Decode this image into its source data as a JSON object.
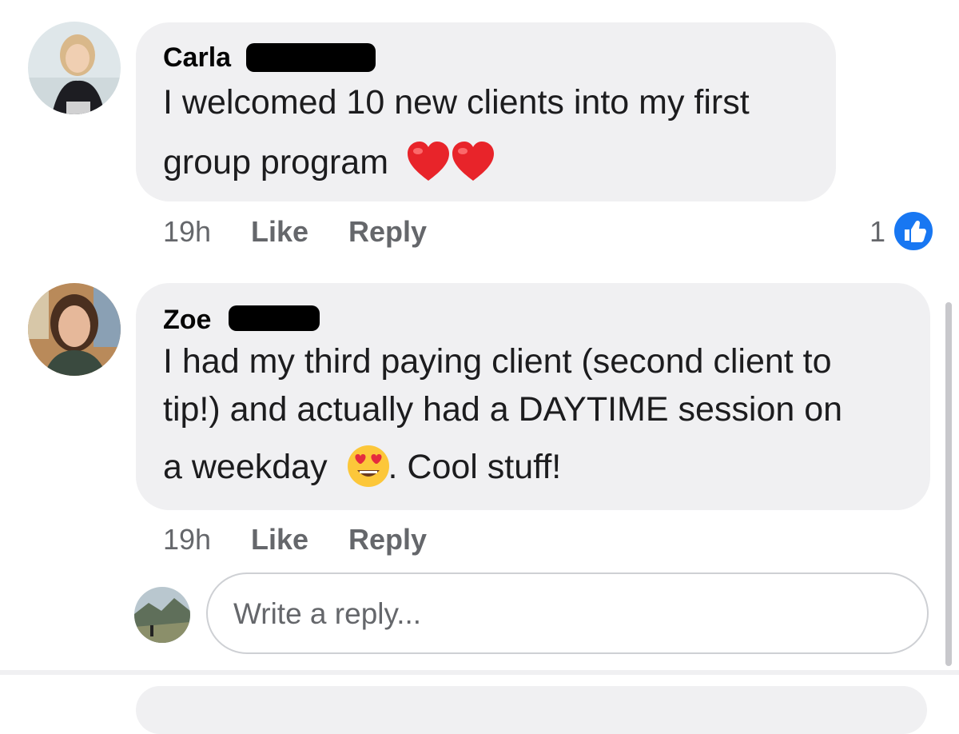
{
  "comments": [
    {
      "author": "Carla",
      "text_lines": [
        "I welcomed 10 new clients into my first",
        "group program"
      ],
      "trailing_emoji": [
        "red-heart",
        "red-heart"
      ],
      "time": "19h",
      "like_label": "Like",
      "reply_label": "Reply",
      "reaction_count": "1",
      "reaction_type": "like"
    },
    {
      "author": "Zoe",
      "text_lines": [
        "I had my third paying client (second client to",
        "tip!) and actually had a DAYTIME session on",
        "a weekday",
        ". Cool stuff!"
      ],
      "inline_emoji": "heart-eyes-face",
      "time": "19h",
      "like_label": "Like",
      "reply_label": "Reply"
    }
  ],
  "reply_input": {
    "placeholder": "Write a reply..."
  },
  "colors": {
    "bubble": "#f0f0f2",
    "meta_text": "#65676b",
    "like_blue": "#1877f2",
    "redaction": "#000000"
  }
}
